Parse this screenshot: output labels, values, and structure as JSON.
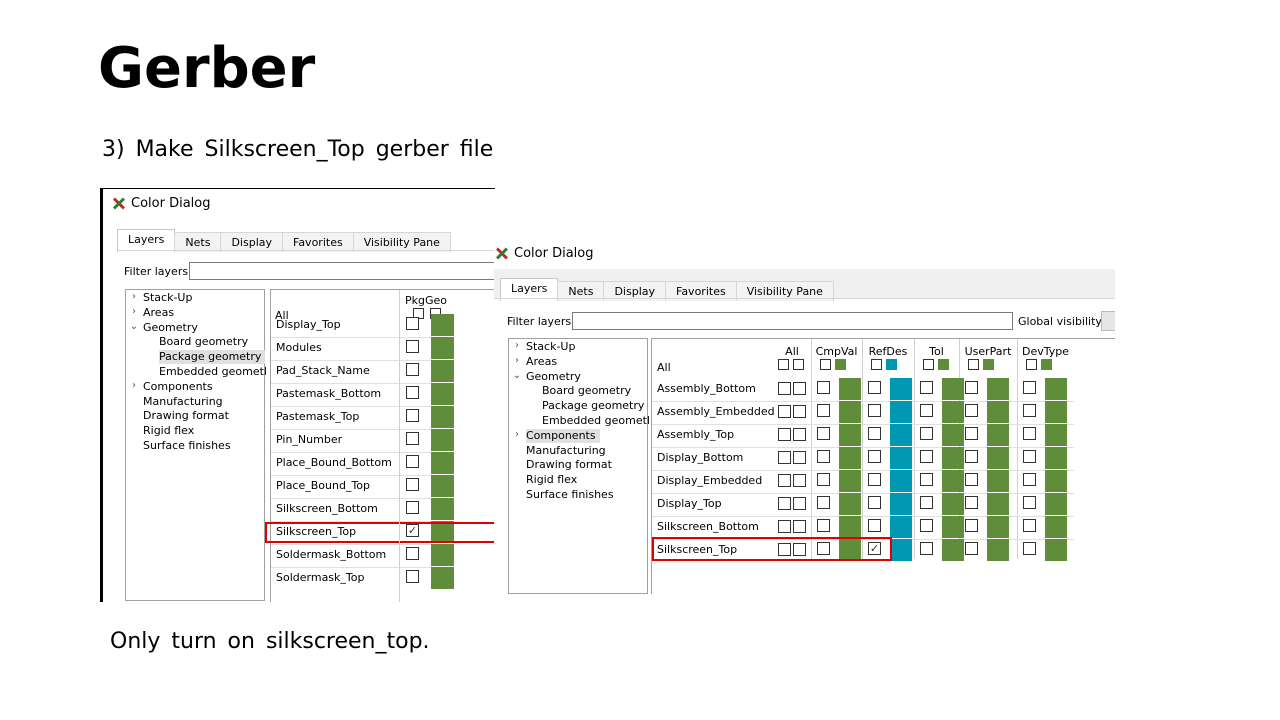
{
  "slide": {
    "title": "Gerber",
    "subtitle": "3) Make Silkscreen_Top gerber file",
    "note": "Only turn on silkscreen_top."
  },
  "colors": {
    "green": "#5f8d3a",
    "cyan": "#0097b2",
    "highlight": "#e00000"
  },
  "dialog1": {
    "title": "Color Dialog",
    "tabs": [
      "Layers",
      "Nets",
      "Display",
      "Favorites",
      "Visibility Pane"
    ],
    "filter_label": "Filter layers:",
    "tree": [
      {
        "label": "Stack-Up",
        "expander": ">"
      },
      {
        "label": "Areas",
        "expander": ">"
      },
      {
        "label": "Geometry",
        "expander": "v"
      },
      {
        "label": "Board geometry",
        "expander": ""
      },
      {
        "label": "Package geometry",
        "expander": "",
        "selected": true
      },
      {
        "label": "Embedded geometl",
        "expander": ""
      },
      {
        "label": "Components",
        "expander": ">"
      },
      {
        "label": "Manufacturing",
        "expander": ""
      },
      {
        "label": "Drawing format",
        "expander": ""
      },
      {
        "label": "Rigid flex",
        "expander": ""
      },
      {
        "label": "Surface finishes",
        "expander": ""
      }
    ],
    "column_header": "PkgGeo",
    "all_label": "All",
    "rows": [
      {
        "label": "Display_Top",
        "checked": false
      },
      {
        "label": "Modules",
        "checked": false
      },
      {
        "label": "Pad_Stack_Name",
        "checked": false
      },
      {
        "label": "Pastemask_Bottom",
        "checked": false
      },
      {
        "label": "Pastemask_Top",
        "checked": false
      },
      {
        "label": "Pin_Number",
        "checked": false
      },
      {
        "label": "Place_Bound_Bottom",
        "checked": false
      },
      {
        "label": "Place_Bound_Top",
        "checked": false
      },
      {
        "label": "Silkscreen_Bottom",
        "checked": false
      },
      {
        "label": "Silkscreen_Top",
        "checked": true,
        "highlighted": true
      },
      {
        "label": "Soldermask_Bottom",
        "checked": false
      },
      {
        "label": "Soldermask_Top",
        "checked": false
      }
    ]
  },
  "dialog2": {
    "title": "Color Dialog",
    "tabs": [
      "Layers",
      "Nets",
      "Display",
      "Favorites",
      "Visibility Pane"
    ],
    "filter_label": "Filter layers:",
    "global_visibility_label": "Global visibility:",
    "tree": [
      {
        "label": "Stack-Up",
        "expander": ">"
      },
      {
        "label": "Areas",
        "expander": ">"
      },
      {
        "label": "Geometry",
        "expander": "v"
      },
      {
        "label": "Board geometry",
        "expander": ""
      },
      {
        "label": "Package geometry",
        "expander": ""
      },
      {
        "label": "Embedded geometl",
        "expander": ""
      },
      {
        "label": "Components",
        "expander": ">",
        "selected": true
      },
      {
        "label": "Manufacturing",
        "expander": ""
      },
      {
        "label": "Drawing format",
        "expander": ""
      },
      {
        "label": "Rigid flex",
        "expander": ""
      },
      {
        "label": "Surface finishes",
        "expander": ""
      }
    ],
    "columns": [
      {
        "name": "All",
        "swatch": ""
      },
      {
        "name": "CmpVal",
        "swatch": "green"
      },
      {
        "name": "RefDes",
        "swatch": "cyan"
      },
      {
        "name": "Tol",
        "swatch": "green"
      },
      {
        "name": "UserPart",
        "swatch": "green"
      },
      {
        "name": "DevType",
        "swatch": "green"
      }
    ],
    "all_label": "All",
    "rows": [
      {
        "label": "Assembly_Bottom",
        "refdes_checked": false
      },
      {
        "label": "Assembly_Embedded",
        "refdes_checked": false
      },
      {
        "label": "Assembly_Top",
        "refdes_checked": false
      },
      {
        "label": "Display_Bottom",
        "refdes_checked": false
      },
      {
        "label": "Display_Embedded",
        "refdes_checked": false
      },
      {
        "label": "Display_Top",
        "refdes_checked": false
      },
      {
        "label": "Silkscreen_Bottom",
        "refdes_checked": false
      },
      {
        "label": "Silkscreen_Top",
        "refdes_checked": true,
        "highlighted": true
      }
    ]
  }
}
